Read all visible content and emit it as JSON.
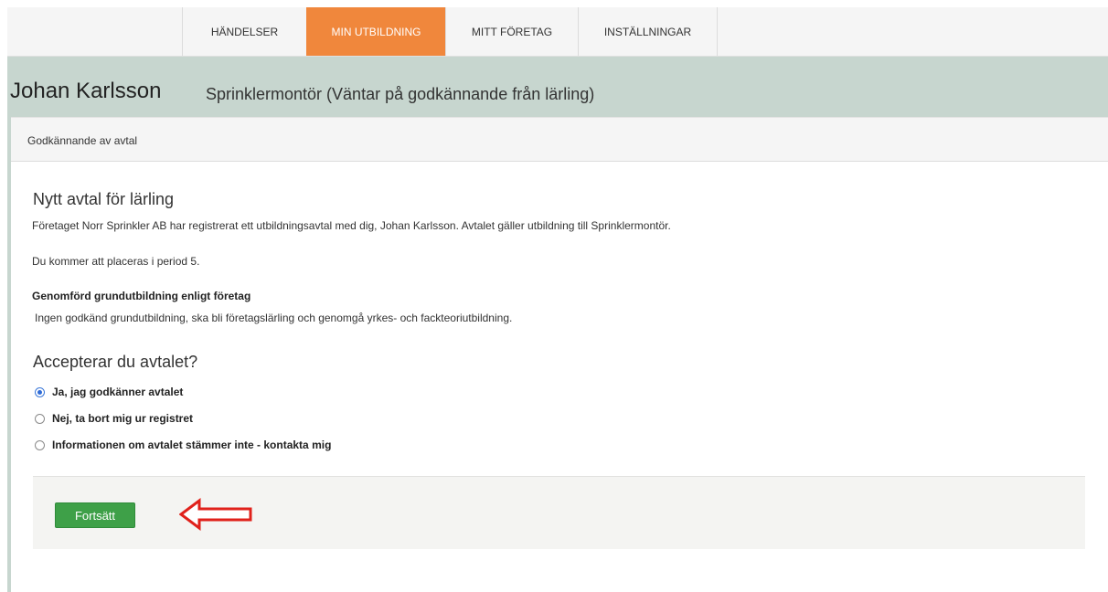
{
  "nav": {
    "tabs": [
      "HÄNDELSER",
      "MIN UTBILDNING",
      "MITT FÖRETAG",
      "INSTÄLLNINGAR"
    ],
    "active_tab": "MIN UTBILDNING",
    "active_color": "#f0873c"
  },
  "header": {
    "name": "Johan Karlsson",
    "role": "Sprinklermontör (Väntar på godkännande från lärling)"
  },
  "panel": {
    "title": "Godkännande av avtal",
    "heading": "Nytt avtal för lärling",
    "intro": "Företaget Norr Sprinkler AB har registrerat ett utbildningsavtal med dig, Johan Karlsson. Avtalet gäller utbildning till Sprinklermontör.",
    "period": "Du kommer att placeras i period 5.",
    "basic_label": "Genomförd grundutbildning enligt företag",
    "basic_value": "Ingen godkänd grundutbildning, ska bli företagslärling och genomgå yrkes- och fackteoriutbildning.",
    "question": "Accepterar du avtalet?",
    "options": [
      {
        "label": "Ja, jag godkänner avtalet",
        "checked": true
      },
      {
        "label": "Nej, ta bort mig ur registret",
        "checked": false
      },
      {
        "label": "Informationen om avtalet stämmer inte - kontakta mig",
        "checked": false
      }
    ],
    "continue_label": "Fortsätt",
    "button_color": "#3ea048",
    "arrow_icon": "left-arrow-icon",
    "arrow_color": "#e0211b"
  }
}
